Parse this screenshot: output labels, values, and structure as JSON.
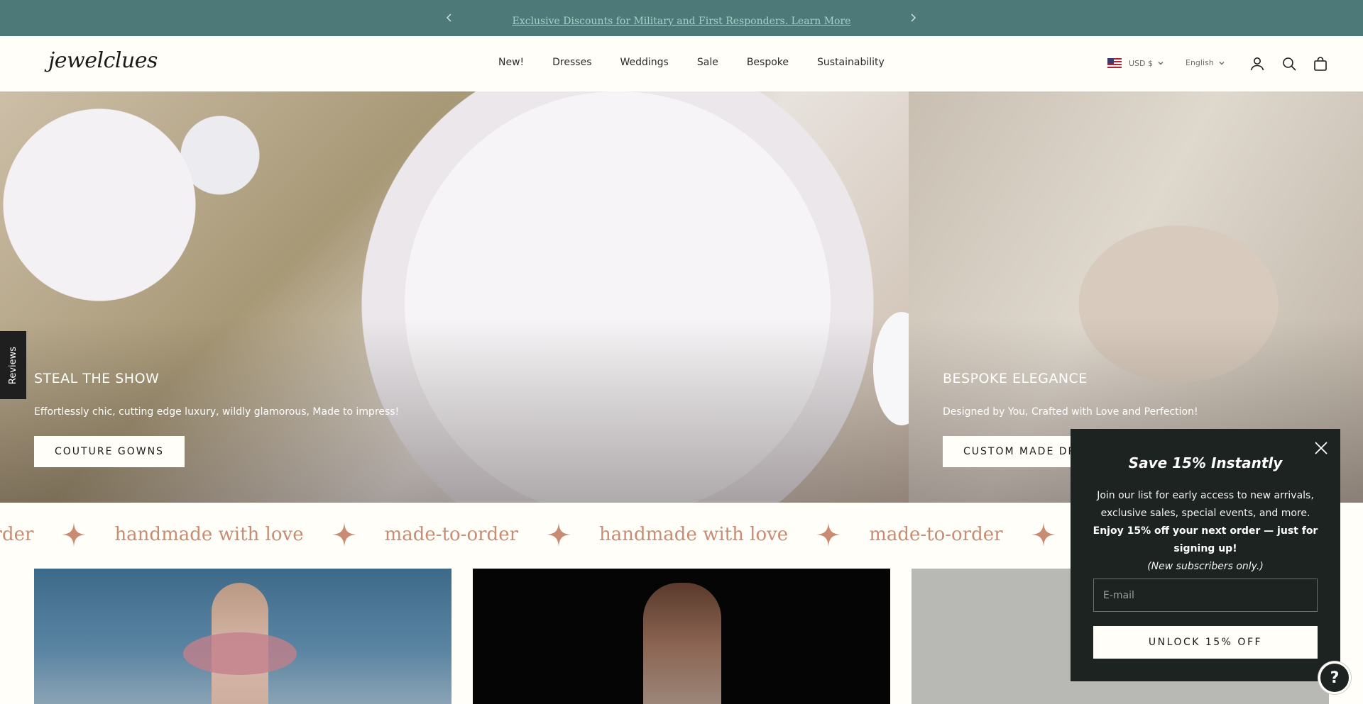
{
  "announcement": {
    "text": "Exclusive Discounts for Military and First Responders. Learn More",
    "prev_icon": "chevron-left-icon",
    "next_icon": "chevron-right-icon",
    "bg_color": "#4d7a78"
  },
  "header": {
    "logo": "jewelclues",
    "nav": [
      "New!",
      "Dresses",
      "Weddings",
      "Sale",
      "Bespoke",
      "Sustainability"
    ],
    "currency": "USD $",
    "language": "English",
    "icons": [
      "account-icon",
      "search-icon",
      "cart-icon"
    ]
  },
  "hero": {
    "left": {
      "title": "STEAL THE SHOW",
      "subtitle": "Effortlessly chic, cutting edge luxury, wildly glamorous, Made to impress!",
      "button": "COUTURE GOWNS"
    },
    "right": {
      "title": "BESPOKE ELEGANCE",
      "subtitle": "Designed by You, Crafted with Love and Perfection!",
      "button": "CUSTOM MADE DRESSES"
    }
  },
  "reviews_tab": "Reviews",
  "marquee": {
    "items": [
      "to-order",
      "handmade with love",
      "made-to-order",
      "handmade with love",
      "made-to-order"
    ],
    "color": "#c98c72"
  },
  "popup": {
    "title": "Save 15% Instantly",
    "body_plain": "Join our list for early access to new arrivals, exclusive sales, special events, and more. ",
    "body_bold": "Enjoy 15% off your next order — just for signing up!",
    "body_italic": "(New subscribers only.)",
    "email_placeholder": "E-mail",
    "button": "UNLOCK 15% OFF"
  },
  "help_button": "?"
}
